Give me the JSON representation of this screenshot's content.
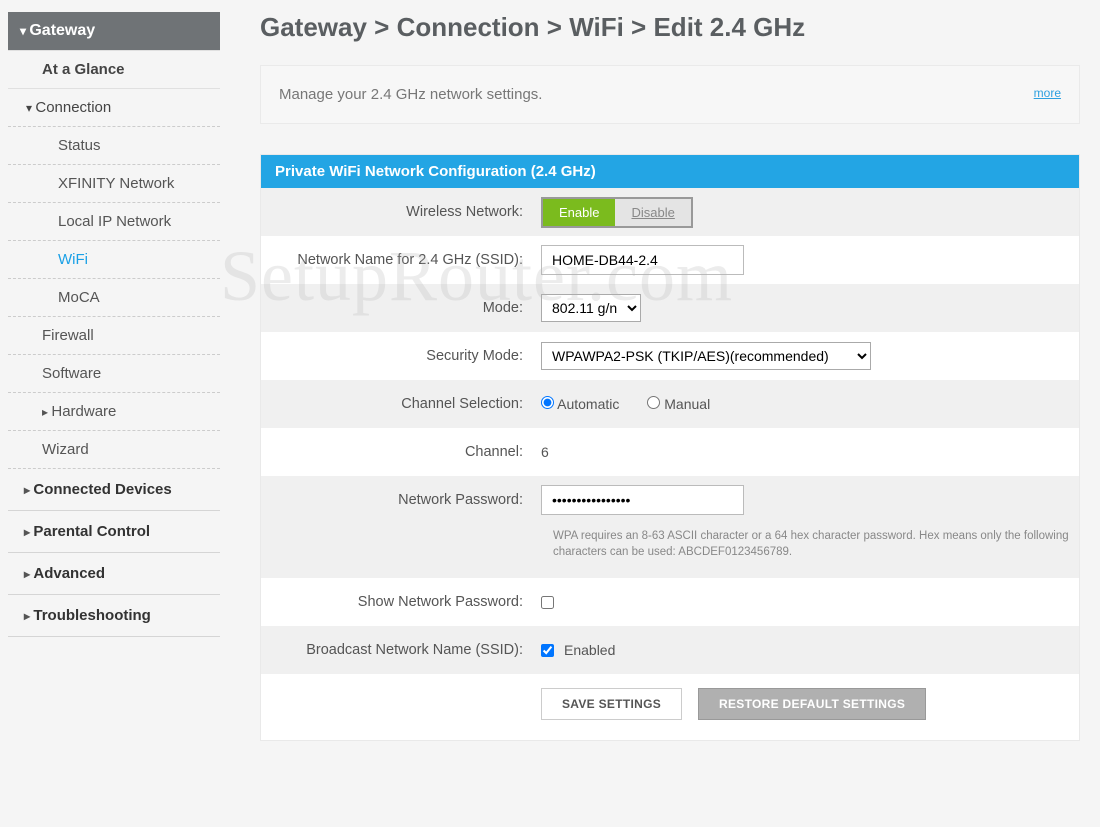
{
  "watermark": "SetupRouter.com",
  "sidebar": {
    "header": "Gateway",
    "items": [
      {
        "label": "At a Glance",
        "cls": "side-sub1 regular"
      },
      {
        "label": "Connection",
        "cls": "side-conn",
        "caret": "down"
      },
      {
        "label": "Status",
        "cls": "side-sub2"
      },
      {
        "label": "XFINITY Network",
        "cls": "side-sub2"
      },
      {
        "label": "Local IP Network",
        "cls": "side-sub2"
      },
      {
        "label": "WiFi",
        "cls": "side-sub2 active"
      },
      {
        "label": "MoCA",
        "cls": "side-sub2"
      },
      {
        "label": "Firewall",
        "cls": "side-sub1-dashed"
      },
      {
        "label": "Software",
        "cls": "side-sub1-dashed"
      },
      {
        "label": "Hardware",
        "cls": "side-sub1-dashed",
        "caret": "right"
      },
      {
        "label": "Wizard",
        "cls": "side-sub1-dashed"
      }
    ],
    "top": [
      "Connected Devices",
      "Parental Control",
      "Advanced",
      "Troubleshooting"
    ]
  },
  "breadcrumb": "Gateway > Connection > WiFi > Edit 2.4 GHz",
  "info": {
    "text": "Manage your 2.4 GHz network settings.",
    "more": "more"
  },
  "panel": {
    "title": "Private WiFi Network Configuration (2.4 GHz)",
    "rows": {
      "wireless_label": "Wireless Network:",
      "enable": "Enable",
      "disable": "Disable",
      "ssid_label": "Network Name for 2.4 GHz (SSID):",
      "ssid_value": "HOME-DB44-2.4",
      "mode_label": "Mode:",
      "mode_value": "802.11 g/n",
      "security_label": "Security Mode:",
      "security_value": "WPAWPA2-PSK (TKIP/AES)(recommended)",
      "chan_sel_label": "Channel Selection:",
      "chan_sel_auto": "Automatic",
      "chan_sel_manual": "Manual",
      "channel_label": "Channel:",
      "channel_value": "6",
      "pass_label": "Network Password:",
      "pass_value": "••••••••••••••••",
      "pass_hint": "WPA requires an 8-63 ASCII character or a 64 hex character password. Hex means only the following characters can be used: ABCDEF0123456789.",
      "show_pass_label": "Show Network Password:",
      "broadcast_label": "Broadcast Network Name (SSID):",
      "broadcast_text": "Enabled",
      "save": "SAVE SETTINGS",
      "restore": "RESTORE DEFAULT SETTINGS"
    }
  }
}
